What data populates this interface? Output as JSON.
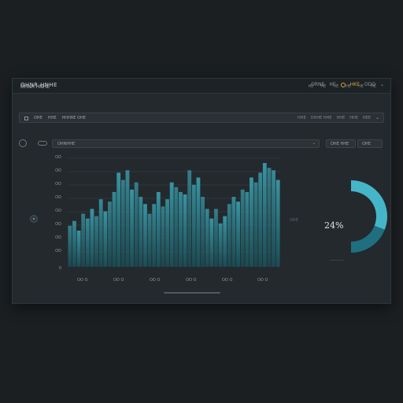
{
  "window": {
    "title": "OHNR HNHE",
    "right_items": [
      "ORNE",
      "HE",
      "HKE",
      "ODO"
    ],
    "close_glyph": "⌄"
  },
  "subheader": {
    "title": "OHNR HNHE",
    "items": [
      "HE",
      "HE",
      "HE",
      "HE",
      "HE",
      "HE"
    ]
  },
  "toolbar": {
    "left_items": [
      "OHE",
      "HHE",
      "HHHRE OHE"
    ],
    "right_items": [
      "HHE",
      "OHHE HHE",
      "HHE",
      "HHE",
      "HEE"
    ]
  },
  "filter": {
    "label": "OHNHHE",
    "right_a": "OHE HHE",
    "right_b": "OHE"
  },
  "colors": {
    "bg": "#1b1f22",
    "panel": "#23292d",
    "accent": "#d7a13d",
    "bar_top": "#3a9aa8",
    "bar_bottom": "#1b4e57",
    "gauge_dark": "#1f6f80",
    "gauge_light": "#45b6c8"
  },
  "icons": [
    "refresh-icon",
    "filter-pill-icon",
    "chevron-down-icon",
    "coin-icon",
    "square-icon"
  ],
  "chart_data": {
    "type": "bar",
    "yticks": [
      "0",
      "OO",
      "OO",
      "OO",
      "OO",
      "OO",
      "OO",
      "OO",
      "OO"
    ],
    "xticks": [
      "OO O",
      "OO O",
      "OO O",
      "OO O",
      "OO O",
      "OO O"
    ],
    "ylim": [
      0,
      90
    ],
    "values": [
      34,
      38,
      30,
      44,
      40,
      48,
      42,
      56,
      46,
      54,
      62,
      78,
      72,
      80,
      64,
      70,
      58,
      52,
      44,
      52,
      62,
      50,
      56,
      70,
      66,
      62,
      60,
      80,
      68,
      74,
      58,
      48,
      40,
      48,
      36,
      42,
      52,
      58,
      54,
      64,
      62,
      74,
      70,
      78,
      86,
      82,
      80,
      72
    ]
  },
  "gauge": {
    "value_label": "24%",
    "segments": [
      0.62,
      0.38
    ],
    "side_label": "OHE"
  }
}
